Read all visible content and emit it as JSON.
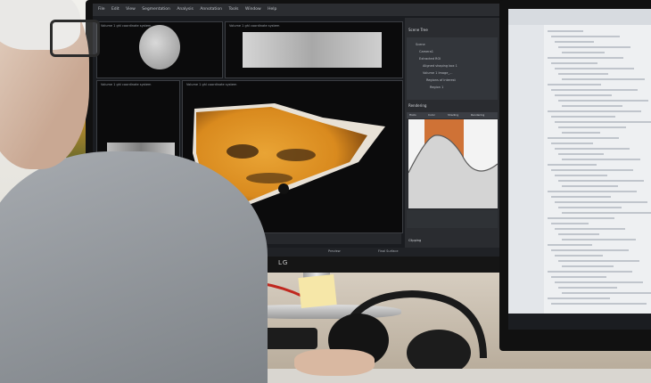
{
  "photo": {
    "monitor_brand": "LG",
    "screen": {
      "menu_items": [
        "File",
        "Edit",
        "View",
        "Segmentation",
        "Analysis",
        "Annotation",
        "Tools",
        "Window",
        "Help"
      ],
      "viewport_titles": [
        "Volume 1 ghl coordinate system",
        "Volume 1 ghl coordinate system",
        "Volume 1 ghl coordinate system",
        "Volume 1 ghl coordinate system"
      ],
      "panel": {
        "scene_tree_title": "Scene Tree",
        "tree_items": [
          "Scene",
          "Camera1",
          "Extracted ROI",
          "Aligned shaping box 1",
          "Volume 1 Image_...",
          "Regions of interest",
          "Region 1"
        ],
        "rendering_title": "Rendering",
        "rendering_tabs": [
          "Histo",
          "Color",
          "Shading",
          "Rendering"
        ],
        "clipping_label": "Clipping"
      },
      "status_items": [
        "Preview",
        "Final Surface"
      ],
      "colors": {
        "sample_orange": "#d98a1e",
        "sample_dark": "#3b2410",
        "ui_dark": "#2a2c30",
        "curve_orange": "#c85a14"
      }
    },
    "second_monitor": {
      "content": "code-editor"
    }
  }
}
